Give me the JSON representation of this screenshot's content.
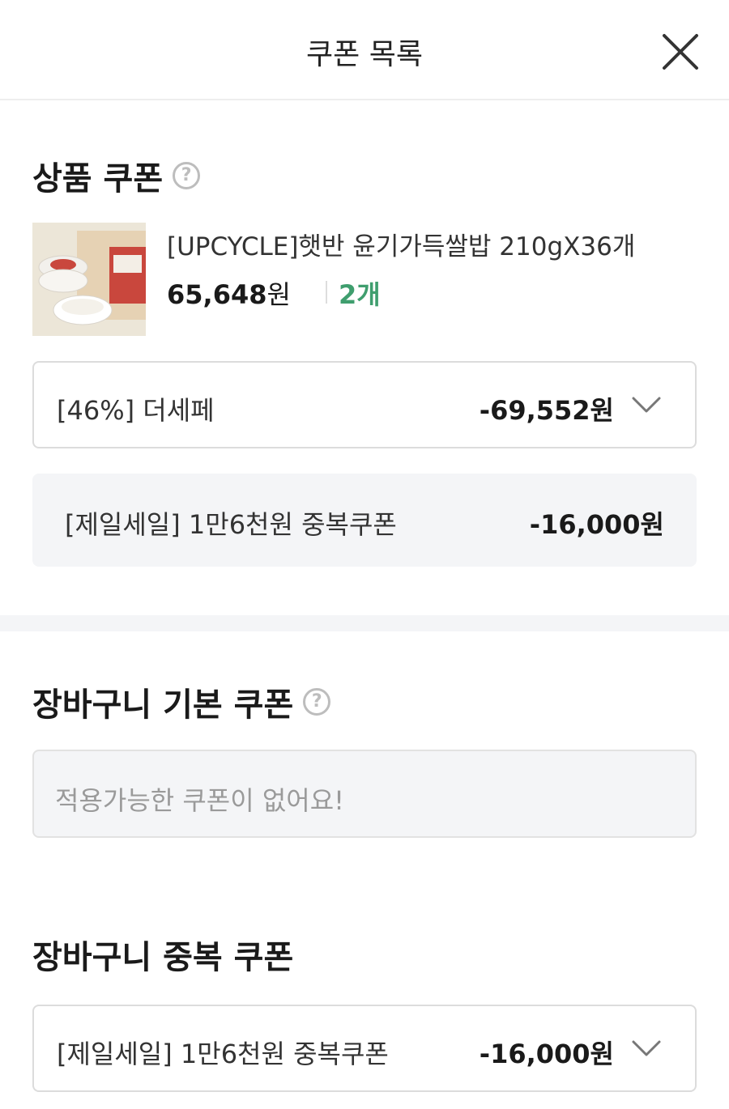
{
  "header": {
    "title": "쿠폰 목록",
    "close_icon": "close-icon"
  },
  "product_coupon": {
    "title": "상품 쿠폰",
    "help_icon": "?",
    "product": {
      "name": "[UPCYCLE]햇반 윤기가득쌀밥 210gX36개",
      "price_number": "65,648",
      "price_unit": "원",
      "quantity": "2개"
    },
    "selected_coupon": {
      "label": "[46%] 더세페",
      "amount": "-69,552원"
    },
    "stacked_coupon": {
      "label": "[제일세일] 1만6천원 중복쿠폰",
      "amount": "-16,000원"
    }
  },
  "cart_basic_coupon": {
    "title": "장바구니 기본 쿠폰",
    "help_icon": "?",
    "empty_message": "적용가능한 쿠폰이 없어요!"
  },
  "cart_stack_coupon": {
    "title": "장바구니 중복 쿠폰",
    "selected_coupon": {
      "label": "[제일세일] 1만6천원 중복쿠폰",
      "amount": "-16,000원"
    }
  },
  "colors": {
    "accent_green": "#3f9e6e",
    "panel_gray": "#f4f5f7",
    "border_gray": "#dcdcdc"
  }
}
